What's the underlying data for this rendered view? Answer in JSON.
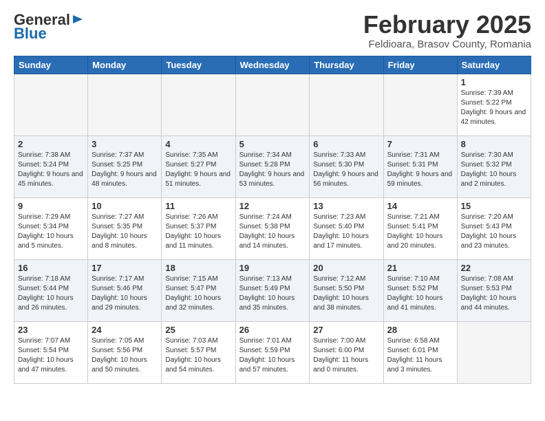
{
  "header": {
    "logo": {
      "general": "General",
      "blue": "Blue"
    },
    "month": "February 2025",
    "location": "Feldioara, Brasov County, Romania"
  },
  "weekdays": [
    "Sunday",
    "Monday",
    "Tuesday",
    "Wednesday",
    "Thursday",
    "Friday",
    "Saturday"
  ],
  "weeks": [
    [
      {
        "day": "",
        "info": ""
      },
      {
        "day": "",
        "info": ""
      },
      {
        "day": "",
        "info": ""
      },
      {
        "day": "",
        "info": ""
      },
      {
        "day": "",
        "info": ""
      },
      {
        "day": "",
        "info": ""
      },
      {
        "day": "1",
        "info": "Sunrise: 7:39 AM\nSunset: 5:22 PM\nDaylight: 9 hours and 42 minutes."
      }
    ],
    [
      {
        "day": "2",
        "info": "Sunrise: 7:38 AM\nSunset: 5:24 PM\nDaylight: 9 hours and 45 minutes."
      },
      {
        "day": "3",
        "info": "Sunrise: 7:37 AM\nSunset: 5:25 PM\nDaylight: 9 hours and 48 minutes."
      },
      {
        "day": "4",
        "info": "Sunrise: 7:35 AM\nSunset: 5:27 PM\nDaylight: 9 hours and 51 minutes."
      },
      {
        "day": "5",
        "info": "Sunrise: 7:34 AM\nSunset: 5:28 PM\nDaylight: 9 hours and 53 minutes."
      },
      {
        "day": "6",
        "info": "Sunrise: 7:33 AM\nSunset: 5:30 PM\nDaylight: 9 hours and 56 minutes."
      },
      {
        "day": "7",
        "info": "Sunrise: 7:31 AM\nSunset: 5:31 PM\nDaylight: 9 hours and 59 minutes."
      },
      {
        "day": "8",
        "info": "Sunrise: 7:30 AM\nSunset: 5:32 PM\nDaylight: 10 hours and 2 minutes."
      }
    ],
    [
      {
        "day": "9",
        "info": "Sunrise: 7:29 AM\nSunset: 5:34 PM\nDaylight: 10 hours and 5 minutes."
      },
      {
        "day": "10",
        "info": "Sunrise: 7:27 AM\nSunset: 5:35 PM\nDaylight: 10 hours and 8 minutes."
      },
      {
        "day": "11",
        "info": "Sunrise: 7:26 AM\nSunset: 5:37 PM\nDaylight: 10 hours and 11 minutes."
      },
      {
        "day": "12",
        "info": "Sunrise: 7:24 AM\nSunset: 5:38 PM\nDaylight: 10 hours and 14 minutes."
      },
      {
        "day": "13",
        "info": "Sunrise: 7:23 AM\nSunset: 5:40 PM\nDaylight: 10 hours and 17 minutes."
      },
      {
        "day": "14",
        "info": "Sunrise: 7:21 AM\nSunset: 5:41 PM\nDaylight: 10 hours and 20 minutes."
      },
      {
        "day": "15",
        "info": "Sunrise: 7:20 AM\nSunset: 5:43 PM\nDaylight: 10 hours and 23 minutes."
      }
    ],
    [
      {
        "day": "16",
        "info": "Sunrise: 7:18 AM\nSunset: 5:44 PM\nDaylight: 10 hours and 26 minutes."
      },
      {
        "day": "17",
        "info": "Sunrise: 7:17 AM\nSunset: 5:46 PM\nDaylight: 10 hours and 29 minutes."
      },
      {
        "day": "18",
        "info": "Sunrise: 7:15 AM\nSunset: 5:47 PM\nDaylight: 10 hours and 32 minutes."
      },
      {
        "day": "19",
        "info": "Sunrise: 7:13 AM\nSunset: 5:49 PM\nDaylight: 10 hours and 35 minutes."
      },
      {
        "day": "20",
        "info": "Sunrise: 7:12 AM\nSunset: 5:50 PM\nDaylight: 10 hours and 38 minutes."
      },
      {
        "day": "21",
        "info": "Sunrise: 7:10 AM\nSunset: 5:52 PM\nDaylight: 10 hours and 41 minutes."
      },
      {
        "day": "22",
        "info": "Sunrise: 7:08 AM\nSunset: 5:53 PM\nDaylight: 10 hours and 44 minutes."
      }
    ],
    [
      {
        "day": "23",
        "info": "Sunrise: 7:07 AM\nSunset: 5:54 PM\nDaylight: 10 hours and 47 minutes."
      },
      {
        "day": "24",
        "info": "Sunrise: 7:05 AM\nSunset: 5:56 PM\nDaylight: 10 hours and 50 minutes."
      },
      {
        "day": "25",
        "info": "Sunrise: 7:03 AM\nSunset: 5:57 PM\nDaylight: 10 hours and 54 minutes."
      },
      {
        "day": "26",
        "info": "Sunrise: 7:01 AM\nSunset: 5:59 PM\nDaylight: 10 hours and 57 minutes."
      },
      {
        "day": "27",
        "info": "Sunrise: 7:00 AM\nSunset: 6:00 PM\nDaylight: 11 hours and 0 minutes."
      },
      {
        "day": "28",
        "info": "Sunrise: 6:58 AM\nSunset: 6:01 PM\nDaylight: 11 hours and 3 minutes."
      },
      {
        "day": "",
        "info": ""
      }
    ]
  ]
}
